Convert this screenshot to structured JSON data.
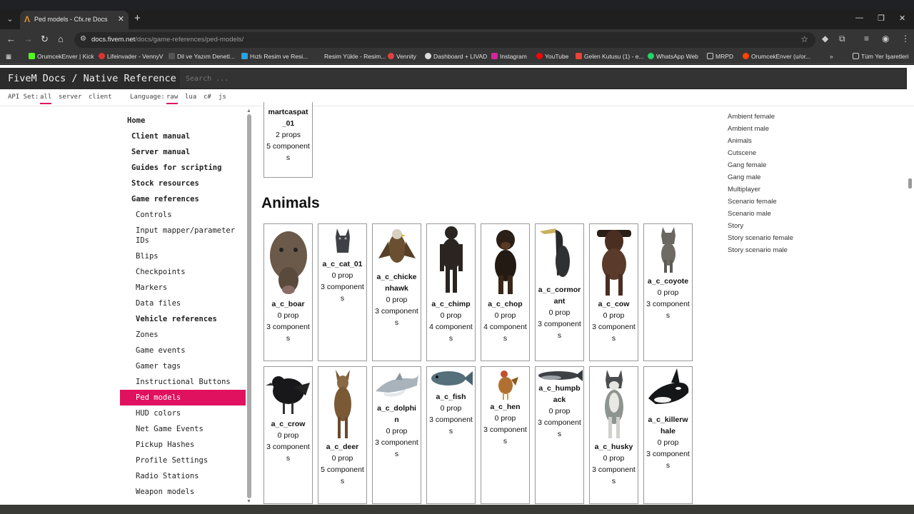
{
  "browser": {
    "tab_title": "Ped models - Cfx.re Docs",
    "url_domain": "docs.fivem.net",
    "url_path": "/docs/game-references/ped-models/",
    "bookmarks": [
      "OrumcekEnver | Kick",
      "Lifeinvader - VennyV",
      "Dil ve Yazım Denetl...",
      "Hızlı Resim ve Resi...",
      "Resim Yükle - Resim...",
      "Vennity",
      "Dashboard + LIVAD",
      "Instagram",
      "YouTube",
      "Gelen Kutusu (1) - e...",
      "WhatsApp Web",
      "MRPD",
      "OrumcekEnver (u/or...",
      "Tüm Yer İşaretleri"
    ],
    "colors": {
      "accent": "#e0115f",
      "topnav_bg": "#2b2b2b",
      "browser_bg": "#353535"
    }
  },
  "site": {
    "brand": "FiveM Docs / Native Reference",
    "search_placeholder": "Search ..."
  },
  "apibar": {
    "api_label": "API Set:",
    "api_options": [
      "all",
      "server",
      "client"
    ],
    "lang_label": "Language:",
    "lang_options": [
      "raw",
      "lua",
      "c#",
      "js"
    ]
  },
  "sidebar": {
    "items": [
      "Home",
      "Client manual",
      "Server manual",
      "Guides for scripting",
      "Stock resources",
      "Game references",
      "Controls",
      "Input mapper/parameter IDs",
      "Blips",
      "Checkpoints",
      "Markers",
      "Data files",
      "Vehicle references",
      "Zones",
      "Game events",
      "Gamer tags",
      "Instructional Buttons",
      "Ped models",
      "HUD colors",
      "Net Game Events",
      "Pickup Hashes",
      "Profile Settings",
      "Radio Stations",
      "Weapon models"
    ]
  },
  "toc": [
    "Ambient female",
    "Ambient male",
    "Animals",
    "Cutscene",
    "Gang female",
    "Gang male",
    "Multiplayer",
    "Scenario female",
    "Scenario male",
    "Story",
    "Story scenario female",
    "Story scenario male"
  ],
  "prev_card": {
    "name": "martcaspat_01",
    "props": "2 props",
    "components": "5 components"
  },
  "section_title": "Animals",
  "animals": [
    {
      "name": "a_c_boar",
      "props": "0 prop",
      "components": "3 components",
      "icon": "boar-image"
    },
    {
      "name": "a_c_cat_01",
      "props": "0 prop",
      "components": "3 components",
      "icon": "cat-image"
    },
    {
      "name": "a_c_chickenhawk",
      "props": "0 prop",
      "components": "3 components",
      "icon": "hawk-image"
    },
    {
      "name": "a_c_chimp",
      "props": "0 prop",
      "components": "4 components",
      "icon": "chimp-image"
    },
    {
      "name": "a_c_chop",
      "props": "0 prop",
      "components": "4 components",
      "icon": "dog-image"
    },
    {
      "name": "a_c_cormorant",
      "props": "0 prop",
      "components": "3 components",
      "icon": "cormorant-image"
    },
    {
      "name": "a_c_cow",
      "props": "0 prop",
      "components": "3 components",
      "icon": "cow-image"
    },
    {
      "name": "a_c_coyote",
      "props": "0 prop",
      "components": "3 components",
      "icon": "coyote-image"
    },
    {
      "name": "a_c_crow",
      "props": "0 prop",
      "components": "3 components",
      "icon": "crow-image"
    },
    {
      "name": "a_c_deer",
      "props": "0 prop",
      "components": "5 components",
      "icon": "deer-image"
    },
    {
      "name": "a_c_dolphin",
      "props": "0 prop",
      "components": "3 components",
      "icon": "dolphin-image"
    },
    {
      "name": "a_c_fish",
      "props": "0 prop",
      "components": "3 components",
      "icon": "fish-image"
    },
    {
      "name": "a_c_hen",
      "props": "0 prop",
      "components": "3 components",
      "icon": "hen-image"
    },
    {
      "name": "a_c_humpback",
      "props": "0 prop",
      "components": "3 components",
      "icon": "whale-image"
    },
    {
      "name": "a_c_husky",
      "props": "0 prop",
      "components": "3 components",
      "icon": "husky-image"
    },
    {
      "name": "a_c_killerwhale",
      "props": "0 prop",
      "components": "3 components",
      "icon": "orca-image"
    }
  ]
}
